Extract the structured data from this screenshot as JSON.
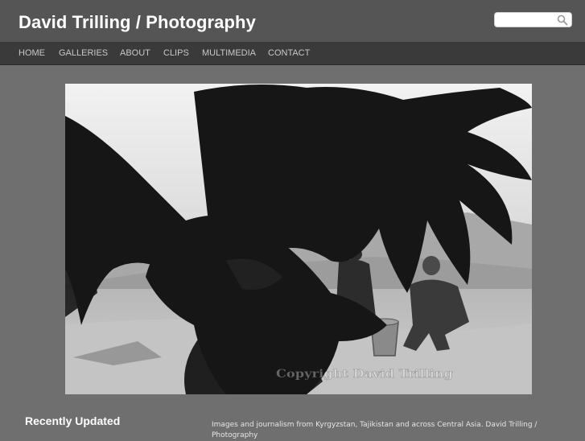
{
  "header": {
    "site_title": "David Trilling / Photography",
    "search": {
      "placeholder": "",
      "value": "",
      "icon": "search-icon"
    }
  },
  "nav": {
    "items": [
      {
        "label": "HOME"
      },
      {
        "label": "GALLERIES"
      },
      {
        "label": "ABOUT"
      },
      {
        "label": "CLIPS"
      },
      {
        "label": "MULTIMEDIA"
      },
      {
        "label": "CONTACT"
      }
    ]
  },
  "featured_photo": {
    "watermark": "Copyright David Trilling"
  },
  "footer": {
    "recently_updated_heading": "Recently Updated",
    "description": "Images and journalism from Kyrgyzstan, Tajikistan and across Central Asia. David Trilling / Photography"
  },
  "colors": {
    "page_background": "#6f6f6f",
    "header_background": "#555555",
    "nav_background": "#3a3a3a",
    "nav_text": "#c8c8c8",
    "title_text": "#ffffff"
  }
}
